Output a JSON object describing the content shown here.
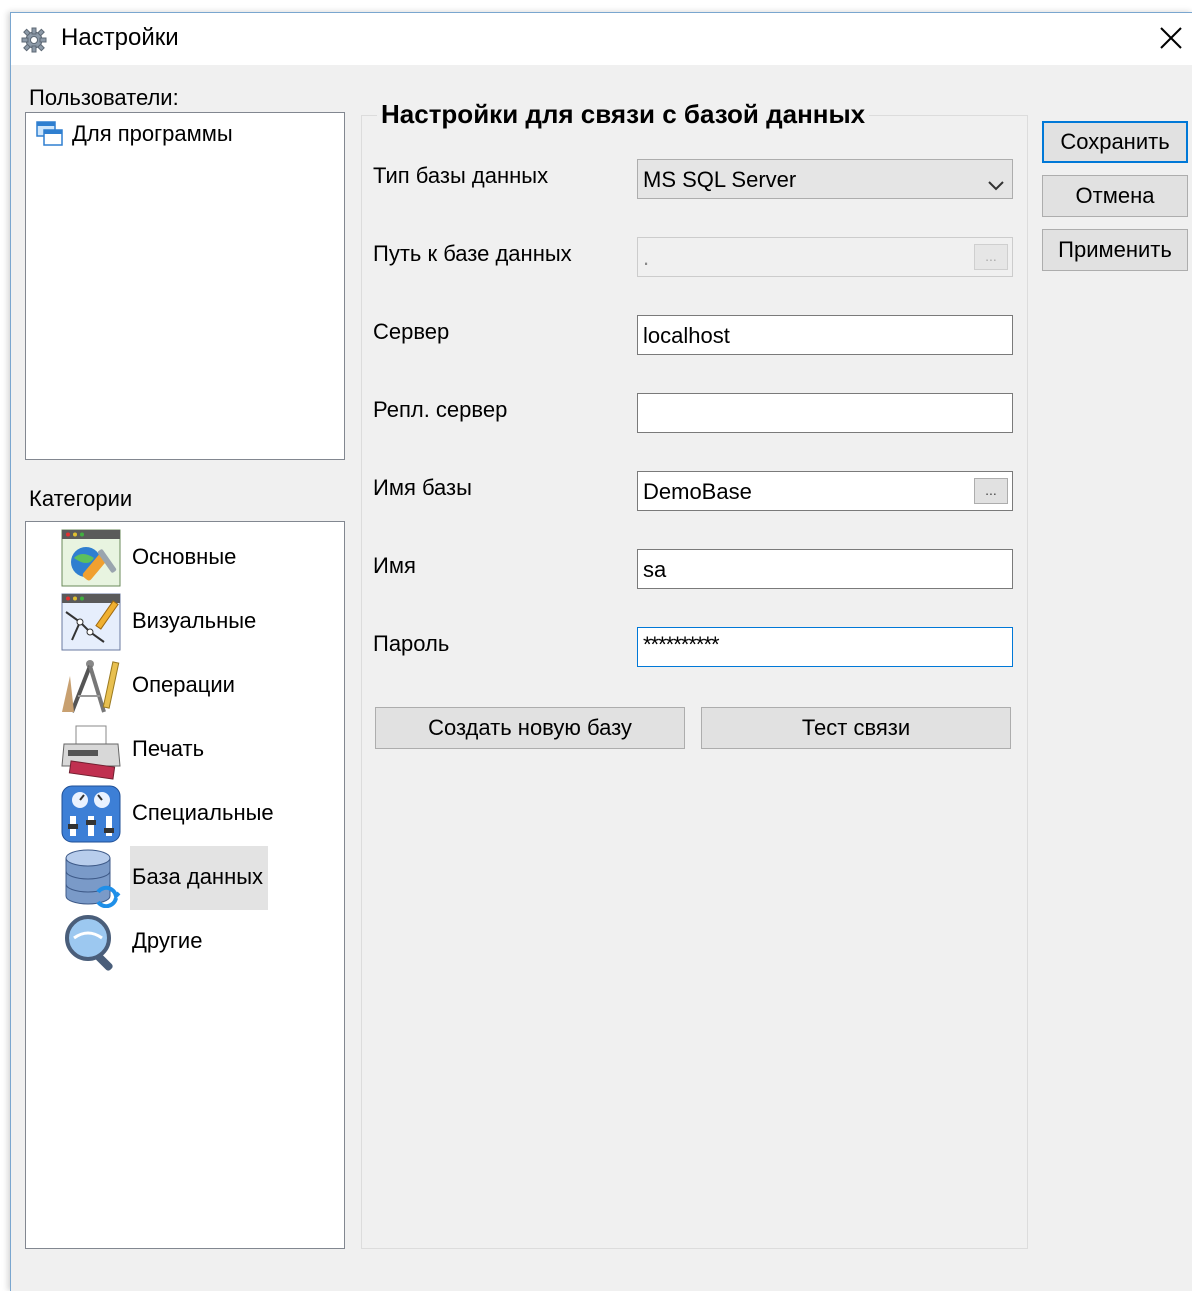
{
  "window": {
    "title": "Настройки"
  },
  "users": {
    "label": "Пользователи:",
    "items": [
      "Для программы"
    ]
  },
  "categories": {
    "label": "Категории",
    "items": [
      "Основные",
      "Визуальные",
      "Операции",
      "Печать",
      "Специальные",
      "База данных",
      "Другие"
    ],
    "selected": "База данных"
  },
  "db": {
    "title": "Настройки для связи с базой данных",
    "type_label": "Тип базы данных",
    "type_value": "MS SQL Server",
    "path_label": "Путь к базе данных",
    "path_value": ".",
    "server_label": "Сервер",
    "server_value": "localhost",
    "repl_label": "Репл. сервер",
    "repl_value": "",
    "dbname_label": "Имя базы",
    "dbname_value": "DemoBase",
    "user_label": "Имя",
    "user_value": "sa",
    "password_label": "Пароль",
    "password_value": "**********",
    "ellipsis": "...",
    "create_button": "Создать новую базу",
    "test_button": "Тест связи"
  },
  "actions": {
    "save": "Сохранить",
    "cancel": "Отмена",
    "apply": "Применить"
  },
  "colors": {
    "accent_border": "#0078d7",
    "selected_bg": "#e3e3e3",
    "window_bg": "#f0f0f0"
  }
}
